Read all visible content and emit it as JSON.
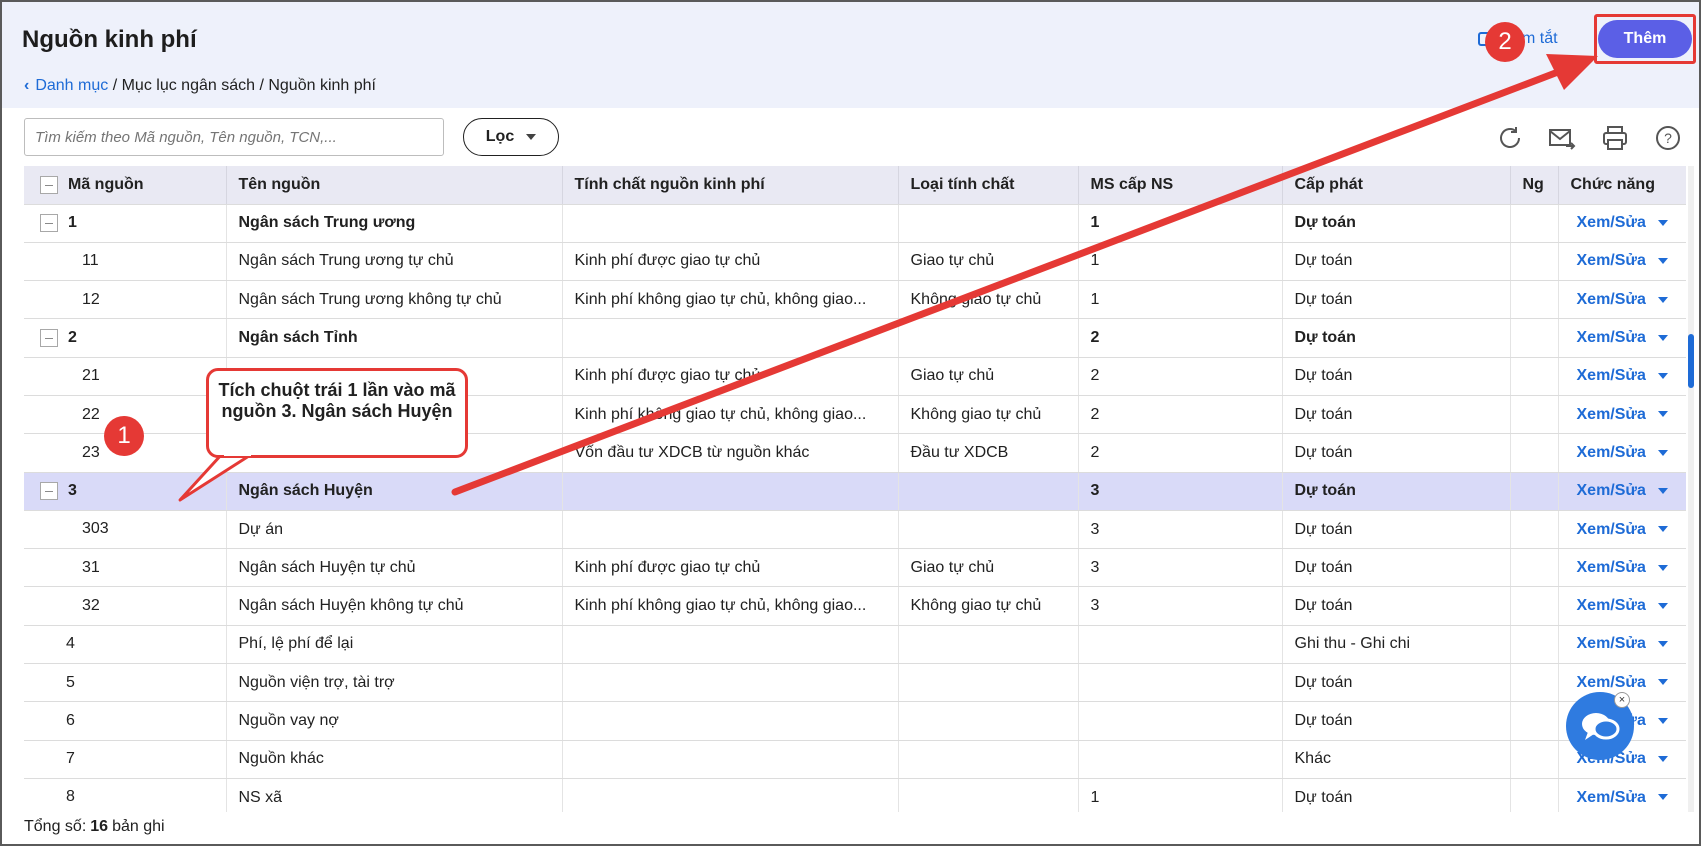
{
  "header": {
    "title": "Nguồn kinh phí",
    "breadcrumb": [
      "Danh mục",
      "Mục lục ngân sách",
      "Nguồn kinh phí"
    ],
    "shortcut_label": "Phím tắt",
    "add_label": "Thêm",
    "colors": {
      "accent": "#5b5fe6",
      "link": "#1e6bd6",
      "annotation": "#e53935"
    }
  },
  "toolbar": {
    "search_placeholder": "Tìm kiếm theo Mã nguồn, Tên nguồn, TCN,...",
    "filter_label": "Lọc",
    "icons": [
      "refresh-icon",
      "email-icon",
      "print-icon",
      "help-icon"
    ]
  },
  "table": {
    "columns": [
      "Mã nguồn",
      "Tên nguồn",
      "Tính chất nguồn kinh phí",
      "Loại tính chất",
      "MS cấp NS",
      "Cấp phát",
      "Ng",
      "Chức năng"
    ],
    "rows": [
      {
        "code": "1",
        "name": "Ngân sách Trung ương",
        "nature": "",
        "type": "",
        "ms": "1",
        "alloc": "Dự toán",
        "action": "Xem/Sửa",
        "level": 0,
        "group": true
      },
      {
        "code": "11",
        "name": "Ngân sách Trung ương tự chủ",
        "nature": "Kinh phí được giao tự chủ",
        "type": "Giao tự chủ",
        "ms": "1",
        "alloc": "Dự toán",
        "action": "Xem/Sửa",
        "level": 2
      },
      {
        "code": "12",
        "name": "Ngân sách Trung ương không tự chủ",
        "nature": "Kinh phí không giao tự chủ, không giao...",
        "type": "Không giao tự chủ",
        "ms": "1",
        "alloc": "Dự toán",
        "action": "Xem/Sửa",
        "level": 2
      },
      {
        "code": "2",
        "name": "Ngân sách Tỉnh",
        "nature": "",
        "type": "",
        "ms": "2",
        "alloc": "Dự toán",
        "action": "Xem/Sửa",
        "level": 0,
        "group": true
      },
      {
        "code": "21",
        "name": "",
        "nature": "Kinh phí được giao tự chủ",
        "type": "Giao tự chủ",
        "ms": "2",
        "alloc": "Dự toán",
        "action": "Xem/Sửa",
        "level": 2
      },
      {
        "code": "22",
        "name": "",
        "nature": "Kinh phí không giao tự chủ, không giao...",
        "type": "Không giao tự chủ",
        "ms": "2",
        "alloc": "Dự toán",
        "action": "Xem/Sửa",
        "level": 2
      },
      {
        "code": "23",
        "name": "",
        "nature": "Vốn đầu tư XDCB từ nguồn khác",
        "type": "Đầu tư XDCB",
        "ms": "2",
        "alloc": "Dự toán",
        "action": "Xem/Sửa",
        "level": 2
      },
      {
        "code": "3",
        "name": "Ngân sách Huyện",
        "nature": "",
        "type": "",
        "ms": "3",
        "alloc": "Dự toán",
        "action": "Xem/Sửa",
        "level": 0,
        "group": true,
        "selected": true
      },
      {
        "code": "303",
        "name": "Dự án",
        "nature": "",
        "type": "",
        "ms": "3",
        "alloc": "Dự toán",
        "action": "Xem/Sửa",
        "level": 2
      },
      {
        "code": "31",
        "name": "Ngân sách Huyện tự chủ",
        "nature": "Kinh phí được giao tự chủ",
        "type": "Giao tự chủ",
        "ms": "3",
        "alloc": "Dự toán",
        "action": "Xem/Sửa",
        "level": 2
      },
      {
        "code": "32",
        "name": "Ngân sách Huyện không tự chủ",
        "nature": "Kinh phí không giao tự chủ, không giao...",
        "type": "Không giao tự chủ",
        "ms": "3",
        "alloc": "Dự toán",
        "action": "Xem/Sửa",
        "level": 2
      },
      {
        "code": "4",
        "name": "Phí, lệ phí để lại",
        "nature": "",
        "type": "",
        "ms": "",
        "alloc": "Ghi thu - Ghi chi",
        "action": "Xem/Sửa",
        "level": 1
      },
      {
        "code": "5",
        "name": "Nguồn viện trợ, tài trợ",
        "nature": "",
        "type": "",
        "ms": "",
        "alloc": "Dự toán",
        "action": "Xem/Sửa",
        "level": 1
      },
      {
        "code": "6",
        "name": "Nguồn vay nợ",
        "nature": "",
        "type": "",
        "ms": "",
        "alloc": "Dự toán",
        "action": "Xem/Sửa",
        "level": 1
      },
      {
        "code": "7",
        "name": "Nguồn khác",
        "nature": "",
        "type": "",
        "ms": "",
        "alloc": "Khác",
        "action": "Xem/Sửa",
        "level": 1
      },
      {
        "code": "8",
        "name": "NS xã",
        "nature": "",
        "type": "",
        "ms": "1",
        "alloc": "Dự toán",
        "action": "Xem/Sửa",
        "level": 1
      }
    ]
  },
  "footer": {
    "total_label": "Tổng số:",
    "total_count": "16",
    "unit": "bản ghi"
  },
  "annotation": {
    "callout_text": "Tích chuột trái 1 lần vào mã nguồn 3. Ngân sách Huyện",
    "step1": "1",
    "step2": "2"
  }
}
